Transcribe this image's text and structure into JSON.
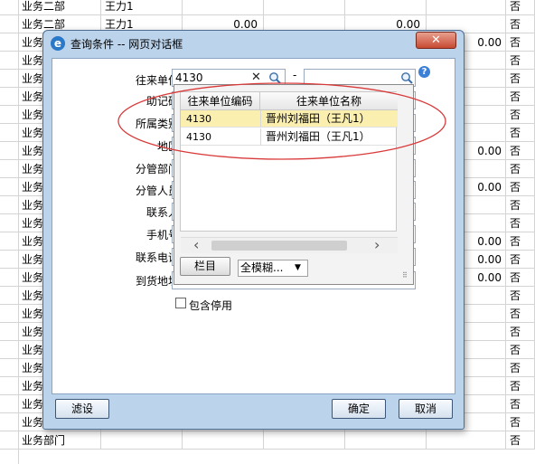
{
  "grid": {
    "rows": [
      {
        "dept": "业务二部",
        "name": "王力1",
        "amt1": "",
        "amt2": "",
        "amt3": "",
        "amt4": "",
        "flag": "否"
      },
      {
        "dept": "业务二部",
        "name": "王力1",
        "amt1": "0.00",
        "amt2": "",
        "amt3": "0.00",
        "amt4": "",
        "flag": "否"
      },
      {
        "dept": "业务部门",
        "name": "",
        "amt1": "",
        "amt2": "",
        "amt3": "",
        "amt4": "0.00",
        "flag": "否"
      },
      {
        "dept": "业务",
        "name": "",
        "amt1": "",
        "amt2": "",
        "amt3": "",
        "amt4": "",
        "flag": "否"
      },
      {
        "dept": "业务",
        "name": "",
        "amt1": "",
        "amt2": "",
        "amt3": "",
        "amt4": "",
        "flag": "否"
      },
      {
        "dept": "业务",
        "name": "",
        "amt1": "",
        "amt2": "",
        "amt3": "",
        "amt4": "",
        "flag": "否"
      },
      {
        "dept": "业务",
        "name": "",
        "amt1": "",
        "amt2": "",
        "amt3": "",
        "amt4": "",
        "flag": "否"
      },
      {
        "dept": "业务",
        "name": "",
        "amt1": "",
        "amt2": "",
        "amt3": "",
        "amt4": "",
        "flag": "否"
      },
      {
        "dept": "业务",
        "name": "",
        "amt1": "",
        "amt2": "",
        "amt3": "",
        "amt4": "0.00",
        "flag": "否"
      },
      {
        "dept": "业务",
        "name": "",
        "amt1": "",
        "amt2": "",
        "amt3": "",
        "amt4": "",
        "flag": "否"
      },
      {
        "dept": "业务",
        "name": "",
        "amt1": "",
        "amt2": "",
        "amt3": "",
        "amt4": "0.00",
        "flag": "否"
      },
      {
        "dept": "业务",
        "name": "",
        "amt1": "",
        "amt2": "",
        "amt3": "",
        "amt4": "",
        "flag": "否"
      },
      {
        "dept": "业务",
        "name": "",
        "amt1": "",
        "amt2": "",
        "amt3": "",
        "amt4": "",
        "flag": "否"
      },
      {
        "dept": "业务",
        "name": "",
        "amt1": "",
        "amt2": "",
        "amt3": "",
        "amt4": "0.00",
        "flag": "否"
      },
      {
        "dept": "业务",
        "name": "",
        "amt1": "",
        "amt2": "",
        "amt3": "",
        "amt4": "0.00",
        "flag": "否"
      },
      {
        "dept": "业务",
        "name": "",
        "amt1": "",
        "amt2": "",
        "amt3": "",
        "amt4": "0.00",
        "flag": "否"
      },
      {
        "dept": "业务",
        "name": "",
        "amt1": "",
        "amt2": "",
        "amt3": "",
        "amt4": "",
        "flag": "否"
      },
      {
        "dept": "业务",
        "name": "",
        "amt1": "",
        "amt2": "",
        "amt3": "",
        "amt4": "",
        "flag": "否"
      },
      {
        "dept": "业务",
        "name": "",
        "amt1": "",
        "amt2": "",
        "amt3": "",
        "amt4": "",
        "flag": "否"
      },
      {
        "dept": "业务",
        "name": "",
        "amt1": "",
        "amt2": "",
        "amt3": "",
        "amt4": "",
        "flag": "否"
      },
      {
        "dept": "业务",
        "name": "",
        "amt1": "",
        "amt2": "",
        "amt3": "",
        "amt4": "",
        "flag": "否"
      },
      {
        "dept": "业务",
        "name": "",
        "amt1": "",
        "amt2": "",
        "amt3": "",
        "amt4": "",
        "flag": "否"
      },
      {
        "dept": "业务",
        "name": "",
        "amt1": "",
        "amt2": "",
        "amt3": "",
        "amt4": "",
        "flag": "否"
      },
      {
        "dept": "业务部门",
        "name": "",
        "amt1": "",
        "amt2": "",
        "amt3": "",
        "amt4": "",
        "flag": "否"
      },
      {
        "dept": "业务部门",
        "name": "",
        "amt1": "",
        "amt2": "",
        "amt3": "",
        "amt4": "",
        "flag": "否"
      }
    ]
  },
  "dialog": {
    "title": "查询条件 -- 网页对话框",
    "close_label": "✕",
    "title_icon": "e",
    "fields": {
      "partner_label": "往来单位",
      "partner_value": "4130",
      "partner_to_value": "",
      "range_dash": "-",
      "mnemonic_label": "助记码",
      "category_label": "所属类别",
      "region_label": "地区",
      "division_label": "分管部门",
      "manager_label": "分管人员",
      "contact_label": "联系人",
      "mobile_label": "手机号",
      "phone_label": "联系电话",
      "address_label": "到货地址"
    },
    "popup": {
      "col_code": "往来单位编码",
      "col_name": "往来单位名称",
      "rows": [
        {
          "code": "4130",
          "name": "晋州刘福田（王凡1）"
        },
        {
          "code": "4130",
          "name": "晋州刘福田（王凡1）"
        }
      ],
      "columns_button": "栏目",
      "match_mode": "全模糊...",
      "scroll_left": "‹",
      "scroll_right": "›"
    },
    "include_disabled_label": "包含停用",
    "include_disabled_checked": false,
    "filter_button": "滤设",
    "ok_button": "确定",
    "cancel_button": "取消"
  },
  "colors": {
    "annotation": "#d93a3a",
    "selected_row": "#fbefb0",
    "dialog_frame": "#bcd3ec"
  },
  "icons": {
    "title": "ie-icon",
    "close": "close-icon",
    "clear": "clear-x-icon",
    "search": "magnifier-icon",
    "help": "help-icon"
  }
}
